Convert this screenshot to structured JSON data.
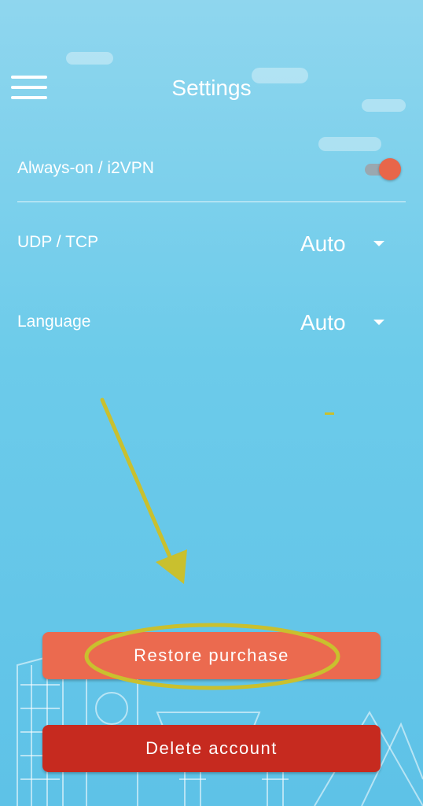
{
  "header": {
    "title": "Settings",
    "menu_icon": "hamburger-menu-icon"
  },
  "settings": {
    "always_on": {
      "label": "Always-on / i2VPN",
      "enabled": true
    },
    "protocol": {
      "label": "UDP / TCP",
      "value": "Auto"
    },
    "language": {
      "label": "Language",
      "value": "Auto"
    }
  },
  "buttons": {
    "restore": "Restore purchase",
    "delete": "Delete account"
  },
  "colors": {
    "accent": "#eb6a4f",
    "danger": "#c62a1f",
    "annotation": "#c9c02e"
  }
}
